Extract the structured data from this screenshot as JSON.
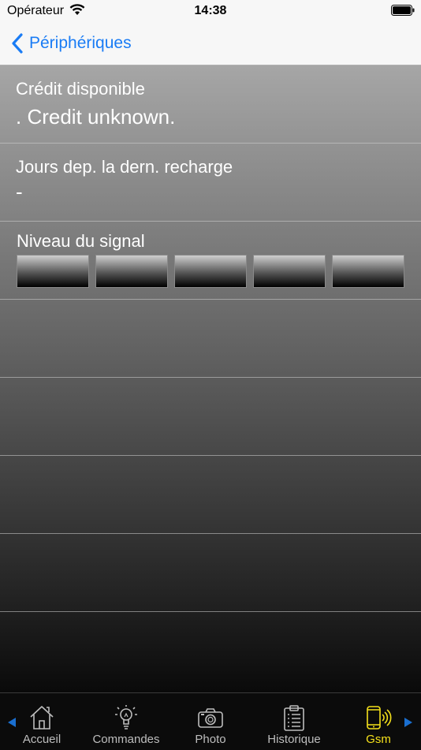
{
  "status_bar": {
    "carrier": "Opérateur",
    "time": "14:38"
  },
  "nav": {
    "back_label": "Périphériques",
    "accent_color": "#1a7cf5"
  },
  "rows": {
    "credit": {
      "label": "Crédit disponible",
      "value": ". Credit unknown."
    },
    "days": {
      "label": "Jours dep. la dern. recharge",
      "value": "-"
    },
    "signal": {
      "label": "Niveau du signal",
      "level_bars_filled": 0,
      "level_bars_total": 5
    }
  },
  "tabs": [
    {
      "label": "Accueil",
      "icon": "home-icon",
      "active": false
    },
    {
      "label": "Commandes",
      "icon": "lightbulb-icon",
      "active": false
    },
    {
      "label": "Photo",
      "icon": "camera-icon",
      "active": false
    },
    {
      "label": "Historique",
      "icon": "clipboard-icon",
      "active": false
    },
    {
      "label": "Gsm",
      "icon": "phone-signal-icon",
      "active": true
    }
  ],
  "colors": {
    "active_tab": "#f5e11b",
    "inactive_tab": "#bdbdbd",
    "arrow": "#1a6fd0"
  }
}
